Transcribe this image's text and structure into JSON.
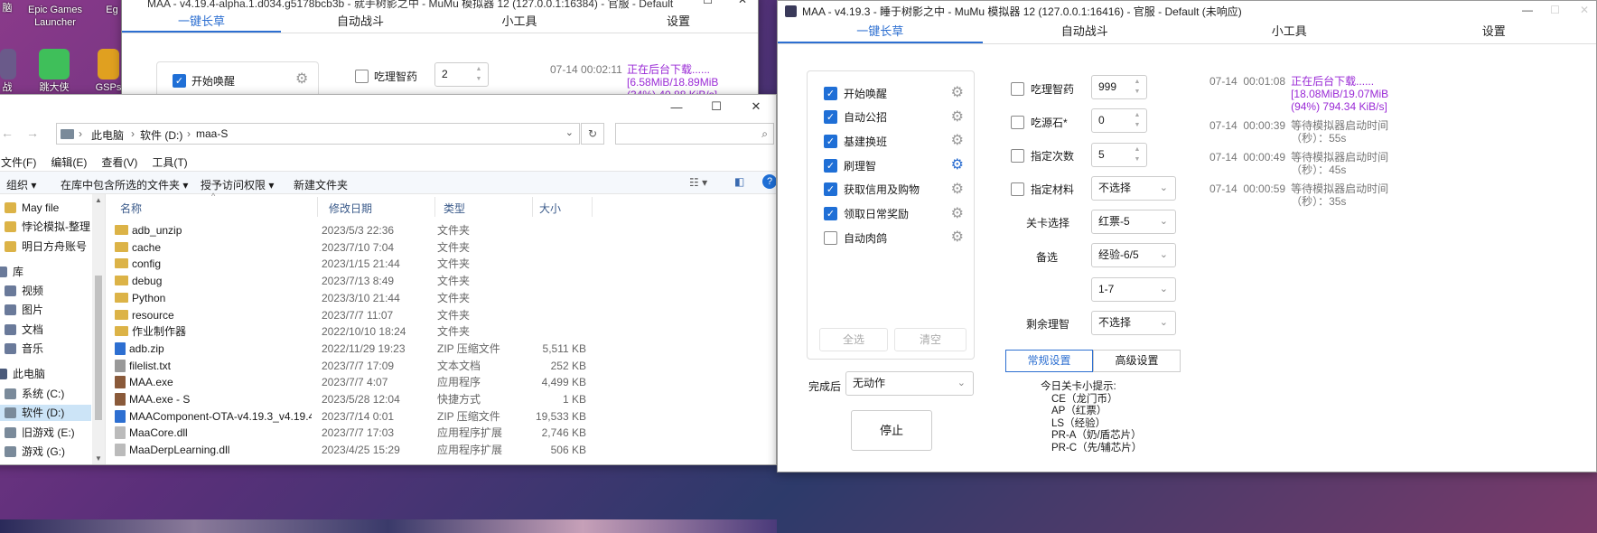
{
  "desktop": {
    "icons": [
      {
        "label": "Epic Games Launcher"
      },
      {
        "label": "Eg"
      },
      {
        "label": "战"
      },
      {
        "label": "跳大侠"
      },
      {
        "label": "GSPs"
      },
      {
        "label": "脑"
      }
    ]
  },
  "bg_maa": {
    "title": "MAA - v4.19.4-alpha.1.d034.g5178bcb3b - 就手树影之中 - MuMu 模拟器 12 (127.0.0.1:16384) - 官服 - Default",
    "tabs": [
      "一键长草",
      "自动战斗",
      "小工具",
      "设置"
    ],
    "task_label": "开始唤醒",
    "sanity_label": "吃理智药",
    "sanity_value": "2",
    "log_time": "07-14  00:02:11",
    "log_text": "正在后台下载......\n[6.58MiB/18.89MiB\n(34%) 40.88 KiB/s]"
  },
  "explorer": {
    "path": [
      "此电脑",
      "软件 (D:)",
      "maa-S"
    ],
    "menu": [
      "文件(F)",
      "编辑(E)",
      "查看(V)",
      "工具(T)"
    ],
    "toolbar": [
      "组织",
      "在库中包含所选的文件夹",
      "授予访问权限",
      "新建文件夹"
    ],
    "columns": [
      "名称",
      "修改日期",
      "类型",
      "大小"
    ],
    "nav": [
      {
        "label": "May file",
        "type": "folder"
      },
      {
        "label": "悖论模拟-整理",
        "type": "folder"
      },
      {
        "label": "明日方舟账号",
        "type": "folder"
      },
      {
        "label": "库",
        "type": "lib"
      },
      {
        "label": "视频",
        "type": "lib"
      },
      {
        "label": "图片",
        "type": "lib"
      },
      {
        "label": "文档",
        "type": "lib"
      },
      {
        "label": "音乐",
        "type": "lib"
      },
      {
        "label": "此电脑",
        "type": "pc"
      },
      {
        "label": "系统 (C:)",
        "type": "drive"
      },
      {
        "label": "软件 (D:)",
        "type": "drive",
        "selected": true
      },
      {
        "label": "旧游戏 (E:)",
        "type": "drive"
      },
      {
        "label": "游戏 (G:)",
        "type": "drive"
      }
    ],
    "files": [
      {
        "name": "adb_unzip",
        "date": "2023/5/3 22:36",
        "type": "文件夹",
        "size": "",
        "kind": "folder"
      },
      {
        "name": "cache",
        "date": "2023/7/10 7:04",
        "type": "文件夹",
        "size": "",
        "kind": "folder"
      },
      {
        "name": "config",
        "date": "2023/1/15 21:44",
        "type": "文件夹",
        "size": "",
        "kind": "folder"
      },
      {
        "name": "debug",
        "date": "2023/7/13 8:49",
        "type": "文件夹",
        "size": "",
        "kind": "folder"
      },
      {
        "name": "Python",
        "date": "2023/3/10 21:44",
        "type": "文件夹",
        "size": "",
        "kind": "folder"
      },
      {
        "name": "resource",
        "date": "2023/7/7 11:07",
        "type": "文件夹",
        "size": "",
        "kind": "folder"
      },
      {
        "name": "作业制作器",
        "date": "2022/10/10 18:24",
        "type": "文件夹",
        "size": "",
        "kind": "folder"
      },
      {
        "name": "adb.zip",
        "date": "2022/11/29 19:23",
        "type": "ZIP 压缩文件",
        "size": "5,511 KB",
        "kind": "zip"
      },
      {
        "name": "filelist.txt",
        "date": "2023/7/7 17:09",
        "type": "文本文档",
        "size": "252 KB",
        "kind": "txt"
      },
      {
        "name": "MAA.exe",
        "date": "2023/7/7 4:07",
        "type": "应用程序",
        "size": "4,499 KB",
        "kind": "exe"
      },
      {
        "name": "MAA.exe - S",
        "date": "2023/5/28 12:04",
        "type": "快捷方式",
        "size": "1 KB",
        "kind": "exe"
      },
      {
        "name": "MAAComponent-OTA-v4.19.3_v4.19.4...",
        "date": "2023/7/14 0:01",
        "type": "ZIP 压缩文件",
        "size": "19,533 KB",
        "kind": "zip"
      },
      {
        "name": "MaaCore.dll",
        "date": "2023/7/7 17:03",
        "type": "应用程序扩展",
        "size": "2,746 KB",
        "kind": "dll"
      },
      {
        "name": "MaaDerpLearning.dll",
        "date": "2023/4/25 15:29",
        "type": "应用程序扩展",
        "size": "506 KB",
        "kind": "dll"
      }
    ]
  },
  "maa": {
    "title": "MAA - v4.19.3 - 睡于树影之中 - MuMu 模拟器 12 (127.0.0.1:16416) - 官服 - Default (未响应)",
    "tabs": [
      "一键长草",
      "自动战斗",
      "小工具",
      "设置"
    ],
    "tasks": [
      {
        "label": "开始唤醒",
        "checked": true,
        "gear_active": false
      },
      {
        "label": "自动公招",
        "checked": true,
        "gear_active": false
      },
      {
        "label": "基建换班",
        "checked": true,
        "gear_active": false
      },
      {
        "label": "刷理智",
        "checked": true,
        "gear_active": true
      },
      {
        "label": "获取信用及购物",
        "checked": true,
        "gear_active": false
      },
      {
        "label": "领取日常奖励",
        "checked": true,
        "gear_active": false
      },
      {
        "label": "自动肉鸽",
        "checked": false,
        "gear_active": false
      }
    ],
    "select_all": "全选",
    "clear": "清空",
    "after_label": "完成后",
    "after_value": "无动作",
    "stop": "停止",
    "options": {
      "sanity_label": "吃理智药",
      "sanity_value": "999",
      "stone_label": "吃源石*",
      "stone_value": "0",
      "times_label": "指定次数",
      "times_value": "5",
      "material_label": "指定材料",
      "material_value": "不选择",
      "stage_label": "关卡选择",
      "stage_value": "红票-5",
      "backup_label": "备选",
      "backup_value": "经验-6/5",
      "backup2_value": "1-7",
      "remain_label": "剩余理智",
      "remain_value": "不选择"
    },
    "settings_tabs": [
      "常规设置",
      "高级设置"
    ],
    "tips_title": "今日关卡小提示:",
    "tips": [
      "CE（龙门币）",
      "AP（红票）",
      "LS（经验）",
      "PR-A（奶/盾芯片）",
      "PR-C（先/辅芯片）"
    ],
    "logs": [
      {
        "time": "07-14  00:01:08",
        "text": "正在后台下载......\n[18.08MiB/19.07MiB\n(94%) 794.34 KiB/s]",
        "color": "#9a2ad6"
      },
      {
        "time": "07-14  00:00:39",
        "text": "等待模拟器启动时间\n（秒）：55s",
        "color": "#777777"
      },
      {
        "time": "07-14  00:00:49",
        "text": "等待模拟器启动时间\n（秒）：45s",
        "color": "#777777"
      },
      {
        "time": "07-14  00:00:59",
        "text": "等待模拟器启动时间\n（秒）：35s",
        "color": "#777777"
      }
    ]
  }
}
